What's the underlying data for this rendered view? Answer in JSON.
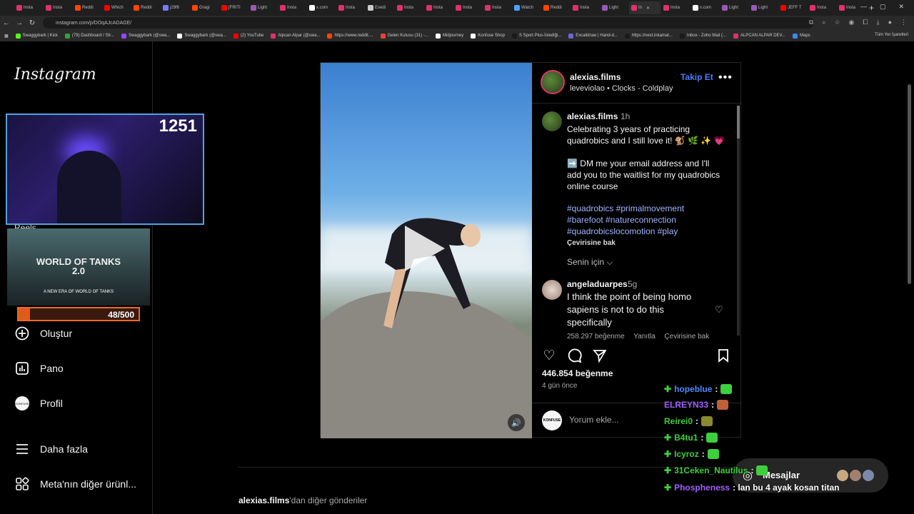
{
  "browser": {
    "tabs": [
      {
        "label": "Insta",
        "color": "#e1306c"
      },
      {
        "label": "Insta",
        "color": "#e1306c"
      },
      {
        "label": "Reddi",
        "color": "#ff4500"
      },
      {
        "label": "Which",
        "color": "#ff0000"
      },
      {
        "label": "Reddi",
        "color": "#ff4500"
      },
      {
        "label": "j29f6",
        "color": "#7a7aff"
      },
      {
        "label": "Gragi",
        "color": "#ff4500"
      },
      {
        "label": "[FRITI",
        "color": "#ff0000"
      },
      {
        "label": "Light",
        "color": "#9b59b6"
      },
      {
        "label": "Insta",
        "color": "#e1306c"
      },
      {
        "label": "x.com",
        "color": "#ffffff"
      },
      {
        "label": "Insta",
        "color": "#e1306c"
      },
      {
        "label": "Evedi",
        "color": "#cccccc"
      },
      {
        "label": "Insta",
        "color": "#e1306c"
      },
      {
        "label": "Insta",
        "color": "#e1306c"
      },
      {
        "label": "Insta",
        "color": "#e1306c"
      },
      {
        "label": "Insta",
        "color": "#e1306c"
      },
      {
        "label": "Watch",
        "color": "#4aa3ff"
      },
      {
        "label": "Reddi",
        "color": "#ff4500"
      },
      {
        "label": "Insta",
        "color": "#e1306c"
      },
      {
        "label": "Light",
        "color": "#9b59b6"
      },
      {
        "label": "In",
        "color": "#e1306c",
        "active": true
      },
      {
        "label": "Insta",
        "color": "#e1306c"
      },
      {
        "label": "x.com",
        "color": "#ffffff"
      },
      {
        "label": "Light",
        "color": "#9b59b6"
      },
      {
        "label": "Light",
        "color": "#9b59b6"
      },
      {
        "label": "JEFF T",
        "color": "#ff0000"
      },
      {
        "label": "Insta",
        "color": "#e1306c"
      },
      {
        "label": "Insta",
        "color": "#e1306c"
      }
    ],
    "url": "instagram.com/p/DOqAJcADAGE/",
    "bookmarks": [
      {
        "label": "Swaggybark | Kick",
        "color": "#53fc18"
      },
      {
        "label": "(79) Dashboard / Str...",
        "color": "#3a9f3a"
      },
      {
        "label": "Swaggybark (@swa...",
        "color": "#9146ff"
      },
      {
        "label": "Swaggybark (@swa...",
        "color": "#ffffff"
      },
      {
        "label": "(2) YouTube",
        "color": "#ff0000"
      },
      {
        "label": "Alpcan Alpar (@swa...",
        "color": "#e1306c"
      },
      {
        "label": "https://www.reddit....",
        "color": "#ff4500"
      },
      {
        "label": "Gelen Kutusu (31) -...",
        "color": "#ea4335"
      },
      {
        "label": "Midjourney",
        "color": "#ffffff"
      },
      {
        "label": "Konfuse Shop",
        "color": "#ffffff"
      },
      {
        "label": "S Sport Plus-İstediği...",
        "color": "#1a1a1a"
      },
      {
        "label": "Excalidraw | Hand-d...",
        "color": "#6965db"
      },
      {
        "label": "https://next.inkamat...",
        "color": "#1a1a1a"
      },
      {
        "label": "Inbox - Zoho Mail (...",
        "color": "#1a1a1a"
      },
      {
        "label": "ALPCAN ALPAR DEV...",
        "color": "#e1306c"
      },
      {
        "label": "Maps",
        "color": "#4285f4"
      }
    ],
    "all_bookmarks": "Tüm Yer İşaretleri"
  },
  "sidebar": {
    "logo": "Instagram",
    "reels_peek": "Reels",
    "items": [
      {
        "label": "Oluştur",
        "icon": "plus-square-icon"
      },
      {
        "label": "Pano",
        "icon": "chart-icon"
      },
      {
        "label": "Profil",
        "icon": "profile-avatar"
      },
      {
        "label": "Daha fazla",
        "icon": "menu-icon"
      },
      {
        "label": "Meta'nın diğer ürünl...",
        "icon": "apps-icon"
      }
    ]
  },
  "stream": {
    "viewer_count": "1251",
    "game_title": "WORLD OF TANKS 2.0",
    "game_subtitle": "A NEW ERA OF WORLD OF TANKS",
    "goal_text": "48/500",
    "goal_fraction": 0.096
  },
  "post": {
    "username": "alexias.films",
    "audio": "leveviolao • Clocks - Coldplay",
    "follow": "Takip Et",
    "caption_time": "1h",
    "caption_lines": [
      "Celebrating 3 years of practicing",
      "quadrobics and I still love it! 🐒 🌿 ✨ 💗",
      "",
      "➡️ DM me your email address and I'll",
      "add you to the waitlist for my quadrobics",
      "online course"
    ],
    "hashtags": [
      "#quadrobics #primalmovement",
      "#barefoot #natureconnection",
      "#quadrobicslocomotion #play"
    ],
    "translate": "Çevirisine bak",
    "for_you": "Senin için",
    "comment": {
      "user": "angeladuarpes",
      "time": "5g",
      "lines": [
        "I think the point of being homo",
        "sapiens is not to do this",
        "specifically"
      ],
      "likes": "258.297 beğenme",
      "reply": "Yanıtla",
      "translate": "Çevirisine bak"
    },
    "likes": "446.854 beğenme",
    "ago": "4 gün önce",
    "comment_placeholder": "Yorum ekle...",
    "commenter_avatar": "KONFUSE"
  },
  "chat": [
    {
      "user": "hopeblue",
      "msg": ":",
      "color": "#4a8cff",
      "badge": true,
      "emote": "#3ecf3e"
    },
    {
      "user": "ELREYN33",
      "msg": ":",
      "color": "#a060ff",
      "badge": false,
      "emote": "#c0603a"
    },
    {
      "user": "Reirei0",
      "msg": ":",
      "color": "#3ecf3e",
      "badge": false,
      "emote": "#8a8a30"
    },
    {
      "user": "B4tu1",
      "msg": ":",
      "color": "#3ecf3e",
      "badge": true,
      "emote": "#3ecf3e"
    },
    {
      "user": "Icyroz",
      "msg": ":",
      "color": "#3ecf3e",
      "badge": true,
      "emote": "#3ecf3e"
    },
    {
      "user": "31Ceken_Nautilus",
      "msg": ":",
      "color": "#3ecf3e",
      "badge": true,
      "emote": "#3ecf3e"
    },
    {
      "user": "Phospheness",
      "msg": ": lan bu 4 ayak kosan titan",
      "color": "#a060ff",
      "badge": true,
      "emote": ""
    }
  ],
  "messages": {
    "label": "Mesajlar"
  },
  "more_posts": {
    "user": "alexias.films",
    "suffix": "'dan diğer gönderiler"
  }
}
